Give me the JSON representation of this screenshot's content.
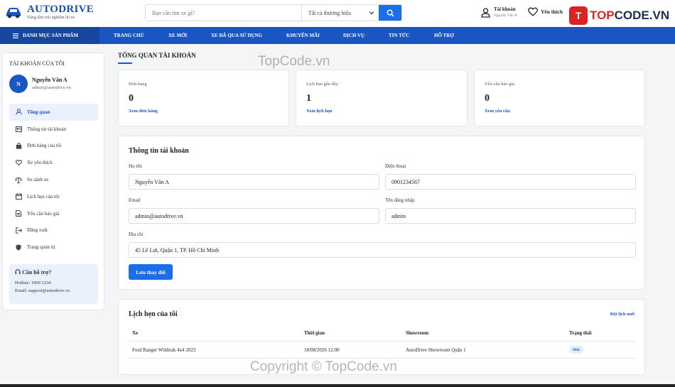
{
  "header": {
    "logo_title": "AUTODRIVE",
    "logo_tagline": "Nâng tầm trải nghiệm lái xe",
    "search_placeholder": "Bạn cần tìm xe gì?",
    "brand_select": "Tất cả thương hiệu",
    "account_label": "Tài khoản",
    "account_user": "Nguyễn Văn A",
    "favorites_label": "Yêu thích"
  },
  "watermark": {
    "brand_prefix": "TOP",
    "brand_suffix": "CODE.VN",
    "brand_icon_letter": "T",
    "center": "TopCode.vn",
    "bottom": "Copyright © TopCode.vn"
  },
  "nav": {
    "category": "DANH MỤC SẢN PHẨM",
    "items": [
      "TRANG CHỦ",
      "XE MỚI",
      "XE ĐÃ QUA SỬ DỤNG",
      "KHUYẾN MÃI",
      "DỊCH VỤ",
      "TIN TỨC",
      "HỖ TRỢ"
    ]
  },
  "sidebar": {
    "title": "TÀI KHOẢN CỦA TÔI",
    "avatar_letter": "N",
    "user_name": "Nguyễn Văn A",
    "user_email": "admin@autodrive.vn",
    "menu": [
      {
        "label": "Tổng quan",
        "icon": "user-icon"
      },
      {
        "label": "Thông tin tài khoản",
        "icon": "id-card-icon"
      },
      {
        "label": "Đơn hàng của tôi",
        "icon": "shopping-bag-icon"
      },
      {
        "label": "Xe yêu thích",
        "icon": "heart-icon"
      },
      {
        "label": "So sánh xe",
        "icon": "scale-icon"
      },
      {
        "label": "Lịch hẹn của tôi",
        "icon": "calendar-icon"
      },
      {
        "label": "Yêu cầu báo giá",
        "icon": "document-icon"
      },
      {
        "label": "Đăng xuất",
        "icon": "logout-icon"
      },
      {
        "label": "Trang quản trị",
        "icon": "shield-icon"
      }
    ],
    "help": {
      "title": "Cần hỗ trợ?",
      "hotline": "Hotline: 1900 1234",
      "email": "Email: support@autodrive.vn"
    }
  },
  "main": {
    "title": "TỔNG QUAN TÀI KHOẢN",
    "stats": [
      {
        "label": "Đơn hàng",
        "value": "0",
        "link": "Xem đơn hàng"
      },
      {
        "label": "Lịch hẹn gần đây",
        "value": "1",
        "link": "Xem lịch hẹn"
      },
      {
        "label": "Yêu cầu báo giá",
        "value": "0",
        "link": "Xem yêu cầu"
      }
    ],
    "account": {
      "title": "Thông tin tài khoản",
      "fullname_label": "Họ tên",
      "fullname": "Nguyễn Văn A",
      "phone_label": "Điện thoại",
      "phone": "0901234567",
      "email_label": "Email",
      "email": "admin@autodrive.vn",
      "username_label": "Tên đăng nhập",
      "username": "admin",
      "address_label": "Địa chỉ",
      "address": "45 Lê Lợi, Quận 1, TP. Hồ Chí Minh",
      "save_label": "Lưu thay đổi"
    },
    "appointments": {
      "title": "Lịch hẹn của tôi",
      "new_link": "Đặt lịch mới",
      "columns": [
        "Xe",
        "Thời gian",
        "Showroom",
        "Trạng thái"
      ],
      "rows": [
        {
          "car": "Ford Ranger Wildtrak 4x4 2023",
          "time": "18/08/2026 12:00",
          "showroom": "AutoDrive Showroom Quận 1",
          "status": "Mới"
        }
      ]
    }
  }
}
